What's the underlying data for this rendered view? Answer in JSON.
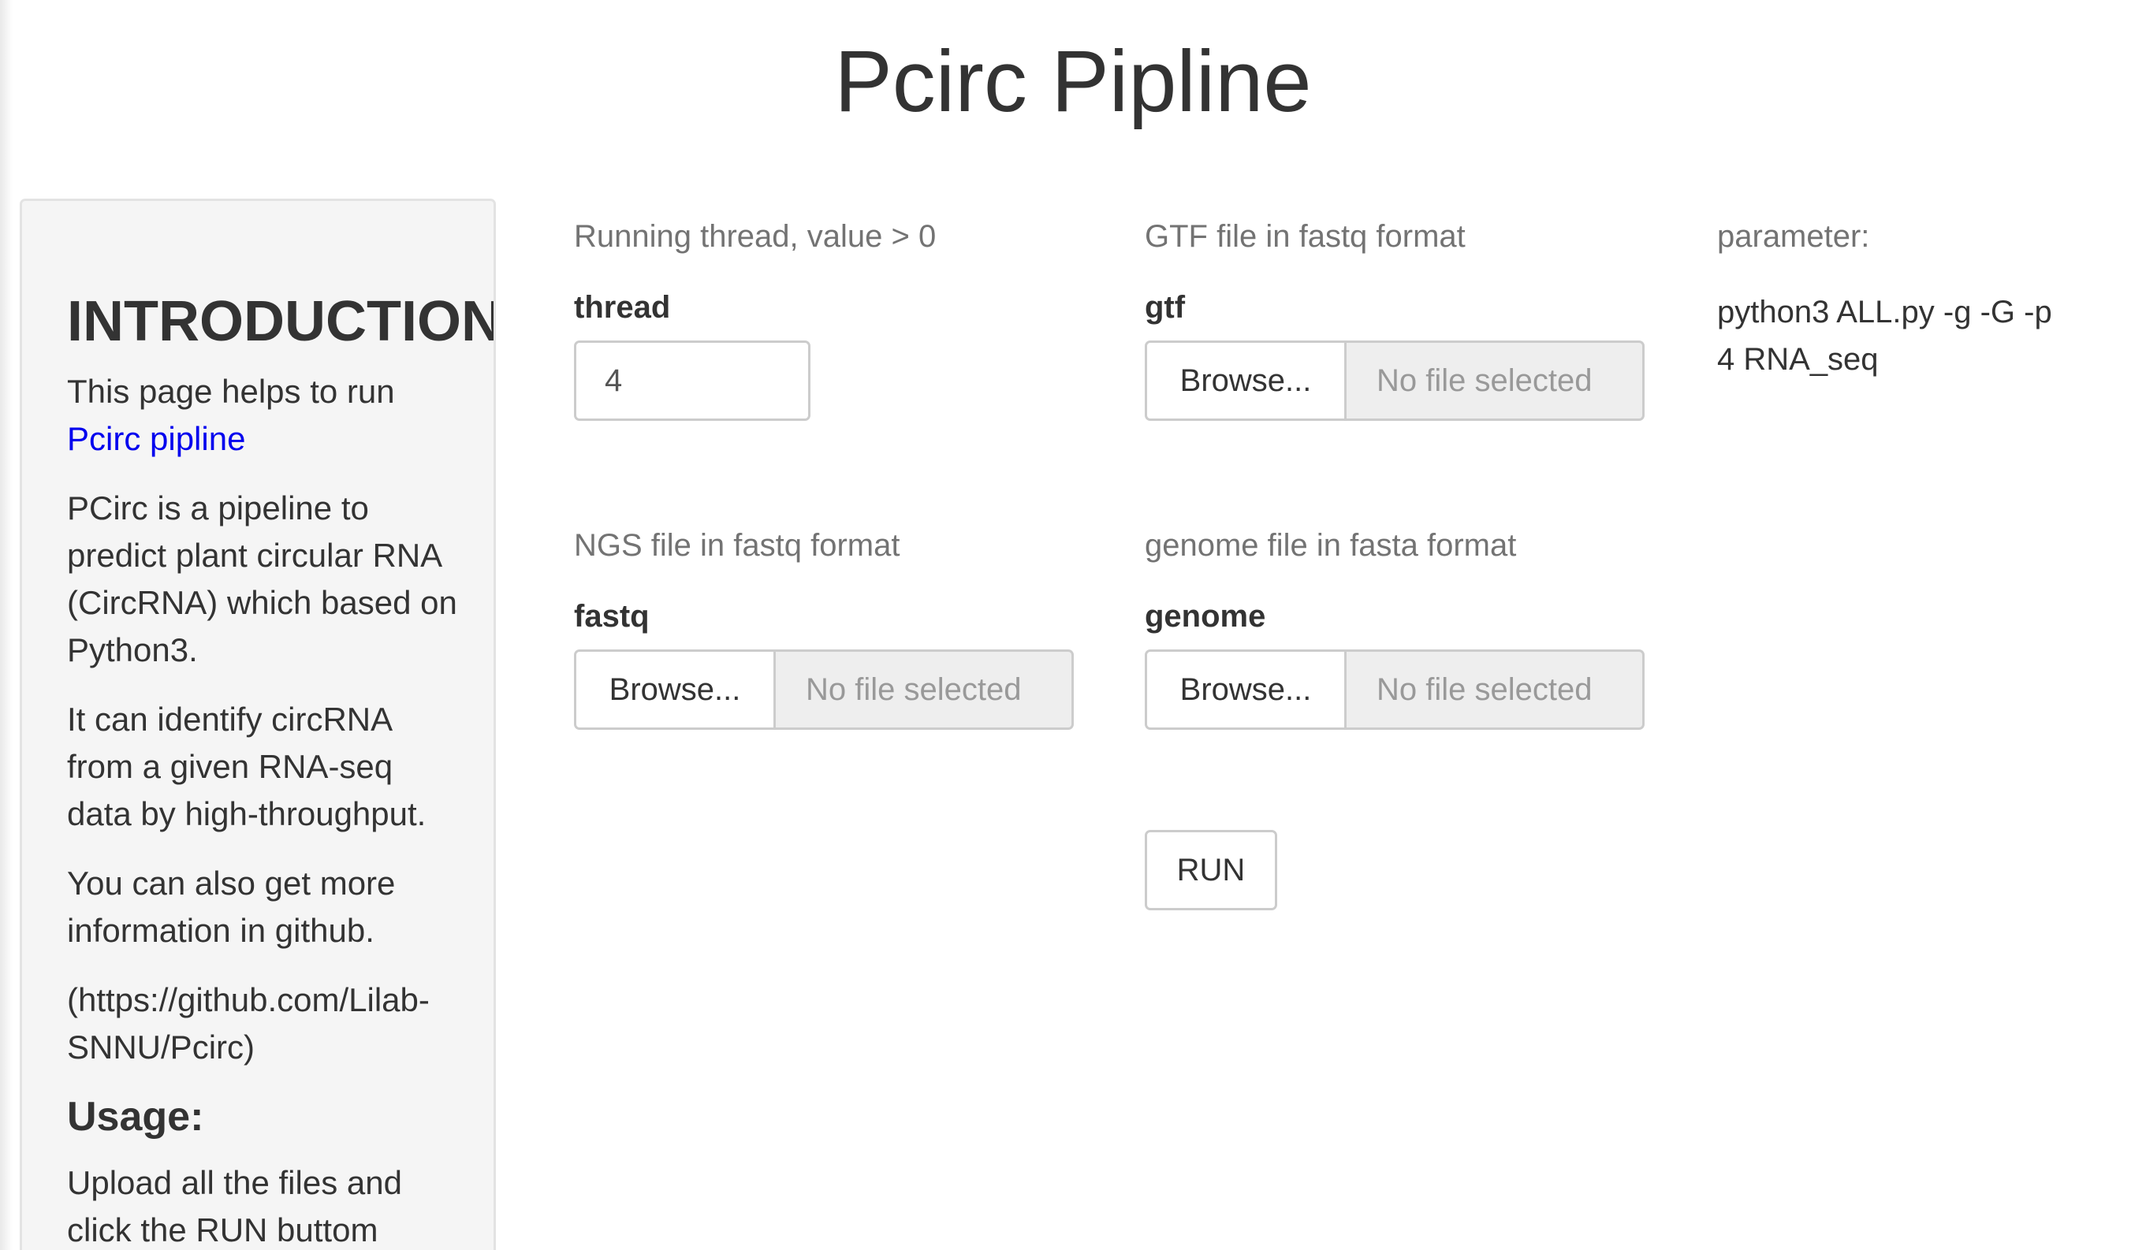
{
  "title": "Pcirc Pipline",
  "sidebar": {
    "heading": "INTRODUCTION",
    "para1_text": "This page helps to run",
    "para1_link": "Pcirc pipline",
    "para2": "PCirc is a pipeline to predict plant circular RNA (CircRNA) which based on Python3.",
    "para3": "It can identify circRNA from a given RNA-seq data by high-throughput.",
    "para4": "You can also get more information in github.",
    "para5": "(https://github.com/Lilab-SNNU/Pcirc)",
    "usage_heading": "Usage:",
    "usage_text": "Upload all the files and click the RUN buttom"
  },
  "form": {
    "thread": {
      "help": "Running thread, value > 0",
      "label": "thread",
      "value": "4"
    },
    "gtf": {
      "help": "GTF file in fastq format",
      "label": "gtf",
      "browse_label": "Browse...",
      "file_status": "No file selected"
    },
    "fastq": {
      "help": "NGS file in fastq format",
      "label": "fastq",
      "browse_label": "Browse...",
      "file_status": "No file selected"
    },
    "genome": {
      "help": "genome file in fasta format",
      "label": "genome",
      "browse_label": "Browse...",
      "file_status": "No file selected"
    },
    "run_label": "RUN"
  },
  "parameter": {
    "label": "parameter:",
    "value": "python3 ALL.py -g -G -p 4 RNA_seq"
  }
}
